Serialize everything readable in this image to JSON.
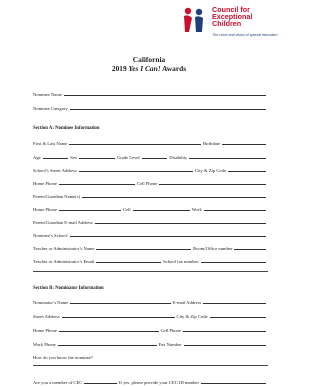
{
  "logo": {
    "title_lines": [
      "Council for",
      "Exceptional",
      "Children"
    ],
    "tagline": "The voice and vision of special education"
  },
  "header": {
    "line1": "California",
    "line2_pre": "2019 ",
    "line2_em": "Yes I Can!",
    "line2_post": " Awards"
  },
  "nominee": {
    "name": "Nominee Name",
    "category": "Nominee Category"
  },
  "section_a": {
    "heading": "Section A: Nominee Information",
    "first_last": "First & Last Name",
    "birthdate": "Birthdate",
    "age": "Age",
    "sex": "Sex",
    "grade": "Grade Level",
    "disability": "Disability",
    "school_address": "School’s Street Address",
    "city_zip": "City & Zip Code",
    "home_phone": "Home Phone",
    "cell_phone": "Cell Phone",
    "guardian_names": "Parent/Guardian Name(s)",
    "home_phone2": "Home Phone",
    "cell2": "Cell",
    "work": "Work",
    "guardian_email": "Parent/Guardian E-mail Address",
    "school": "Nominee’s School:",
    "admin_name": "Teacher or Administrator’s Name",
    "room": "Room/Office number",
    "admin_email": "Teacher or Administrator’s Email",
    "fax": "School fax number:"
  },
  "section_b": {
    "heading": "Section B: Nominator Information",
    "nominator_name": "Nominator’s Name",
    "email": "E-mail Address",
    "street": "Street Address",
    "city_zip": "City & Zip Code",
    "home_phone": "Home Phone",
    "cell_phone": "Cell Phone",
    "work_phone": "Work Phone",
    "fax_number": "Fax Number",
    "how_know": "How do you know the nominee?",
    "cec_pre": "Are you a member of CEC",
    "cec_post": "If yes, please provide your CEC ID number"
  }
}
